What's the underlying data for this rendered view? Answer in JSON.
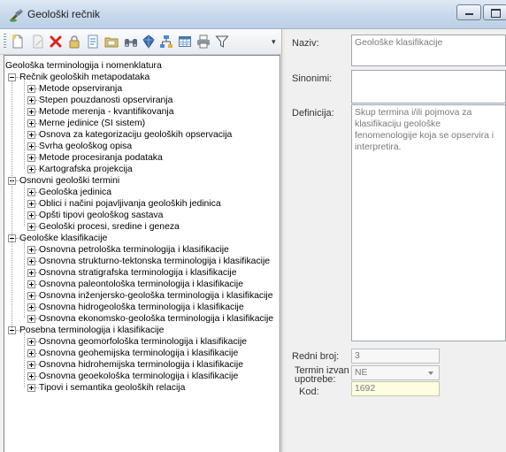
{
  "window": {
    "title": "Geološki rečnik"
  },
  "toolbar": {
    "buttons": [
      {
        "name": "new-icon"
      },
      {
        "name": "edit-icon"
      },
      {
        "name": "delete-icon"
      },
      {
        "name": "lock-icon"
      },
      {
        "name": "document-icon"
      },
      {
        "name": "folder-icon"
      },
      {
        "name": "binoculars-icon"
      },
      {
        "name": "gem-icon"
      },
      {
        "name": "hierarchy-icon"
      },
      {
        "name": "table-icon"
      },
      {
        "name": "print-icon"
      },
      {
        "name": "filter-icon"
      }
    ]
  },
  "tree": {
    "root": "Geološka terminologija i nomenklatura",
    "groups": [
      {
        "label": "Rečnik geoloških metapodataka",
        "items": [
          "Metode opserviranja",
          "Stepen pouzdanosti opserviranja",
          "Metode merenja - kvantifikovanja",
          "Merne jedinice (SI sistem)",
          "Osnova za kategorizaciju geoloških opservacija",
          "Svrha geološkog opisa",
          "Metode procesiranja podataka",
          "Kartografska projekcija"
        ]
      },
      {
        "label": "Osnovni geološki termini",
        "items": [
          "Geološka jedinica",
          "Oblici i načini pojavljivanja geoloških jedinica",
          "Opšti tipovi geološkog sastava",
          "Geološki procesi, sredine i geneza"
        ]
      },
      {
        "label": "Geološke klasifikacije",
        "items": [
          "Osnovna petrološka terminologija i klasifikacije",
          "Osnovna strukturno-tektonska terminologija i klasifikacije",
          "Osnovna stratigrafska terminologija i klasifikacije",
          "Osnovna paleontološka terminologija i klasifikacije",
          "Osnovna inženjersko-geološka terminologija i klasifikacije",
          "Osnovna hidrogeološka terminologija i klasifikacije",
          "Osnovna ekonomsko-geološka terminologija i klasifikacije"
        ]
      },
      {
        "label": "Posebna terminologija i klasifikacije",
        "items": [
          "Osnovna geomorfološka terminologija i klasifikacije",
          "Osnovna geohemijska terminologija i klasifikacije",
          "Osnovna hidrohemijska terminologija i klasifikacije",
          "Osnovna geoekološka terminologija i klasifikacije",
          "Tipovi i semantika geoloških relacija"
        ]
      }
    ]
  },
  "form": {
    "naziv_label": "Naziv:",
    "naziv_value": "Geološke klasifikacije",
    "sinonimi_label": "Sinonimi:",
    "sinonimi_value": "",
    "definicija_label": "Definicija:",
    "definicija_value": "Skup termina i/ili pojmova za klasifikaciju geološke fenomenologije koja se opservira i interpretira.",
    "redni_broj_label": "Redni broj:",
    "redni_broj_value": "3",
    "termin_izvan_label_1": "Termin izvan",
    "termin_izvan_label_2": "upotrebe:",
    "termin_izvan_value": "NE",
    "kod_label": "Kod:",
    "kod_value": "1692"
  },
  "colors": {
    "delete": "#d9261c",
    "tree_border": "#828790",
    "field_text": "#7a7a7a"
  }
}
